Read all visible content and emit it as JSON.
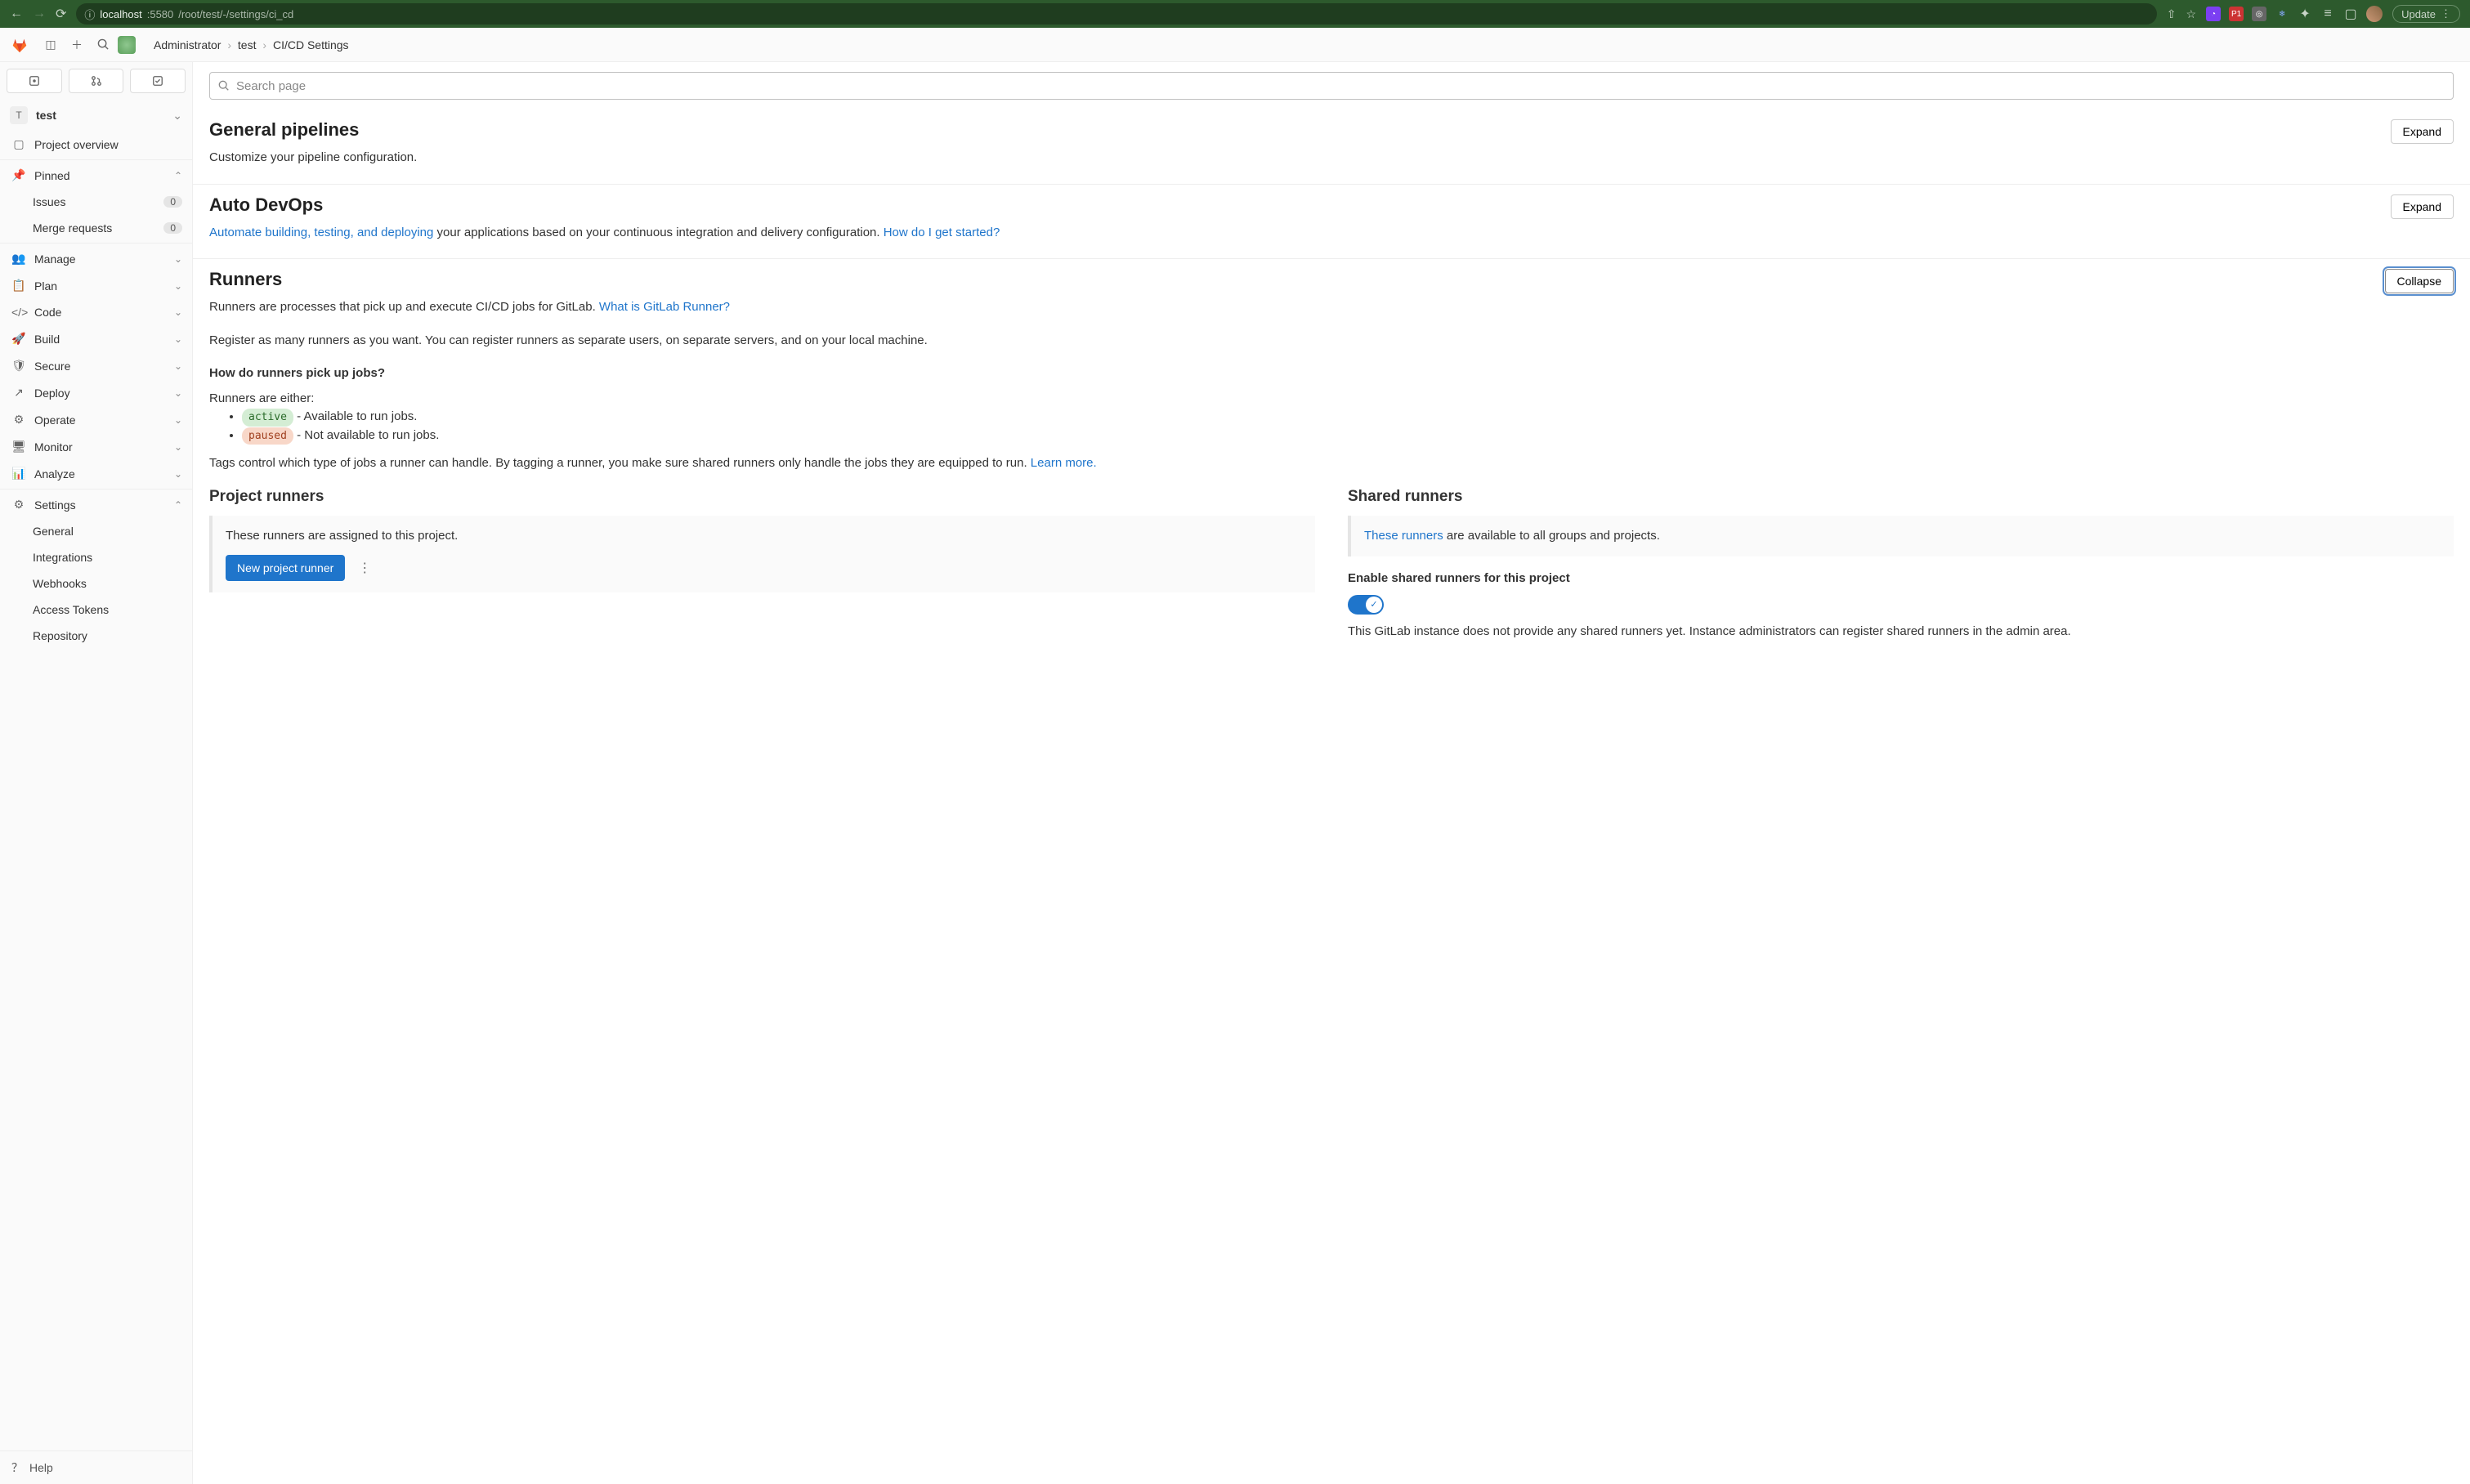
{
  "browser": {
    "url_host": "localhost",
    "url_port": ":5580",
    "url_path": "/root/test/-/settings/ci_cd",
    "update_label": "Update"
  },
  "breadcrumbs": {
    "items": [
      "Administrator",
      "test",
      "CI/CD Settings"
    ]
  },
  "project": {
    "avatar_letter": "T",
    "name": "test"
  },
  "sidebar": {
    "shortcuts": {
      "issues": "⊡",
      "mrs": "⤲",
      "todos": "☑"
    },
    "overview": "Project overview",
    "pinned": "Pinned",
    "pinned_items": [
      {
        "label": "Issues",
        "count": "0"
      },
      {
        "label": "Merge requests",
        "count": "0"
      }
    ],
    "items": [
      "Manage",
      "Plan",
      "Code",
      "Build",
      "Secure",
      "Deploy",
      "Operate",
      "Monitor",
      "Analyze"
    ],
    "settings": "Settings",
    "settings_items": [
      "General",
      "Integrations",
      "Webhooks",
      "Access Tokens",
      "Repository"
    ],
    "help": "Help"
  },
  "search": {
    "placeholder": "Search page"
  },
  "sections": {
    "general": {
      "title": "General pipelines",
      "desc": "Customize your pipeline configuration.",
      "btn": "Expand"
    },
    "devops": {
      "title": "Auto DevOps",
      "link1": "Automate building, testing, and deploying",
      "desc_mid": " your applications based on your continuous integration and delivery configuration. ",
      "link2": "How do I get started?",
      "btn": "Expand"
    },
    "runners": {
      "title": "Runners",
      "btn": "Collapse",
      "desc1": "Runners are processes that pick up and execute CI/CD jobs for GitLab. ",
      "link1": "What is GitLab Runner?",
      "desc2": "Register as many runners as you want. You can register runners as separate users, on separate servers, and on your local machine.",
      "subhead": "How do runners pick up jobs?",
      "either": "Runners are either:",
      "active_pill": "active",
      "active_text": "  - Available to run jobs.",
      "paused_pill": "paused",
      "paused_text": "  - Not available to run jobs.",
      "tags": "Tags control which type of jobs a runner can handle. By tagging a runner, you make sure shared runners only handle the jobs they are equipped to run. ",
      "learn_more": "Learn more.",
      "project_runners": {
        "title": "Project runners",
        "desc": "These runners are assigned to this project.",
        "btn": "New project runner"
      },
      "shared_runners": {
        "title": "Shared runners",
        "link": "These runners",
        "desc": " are available to all groups and projects.",
        "toggle_label": "Enable shared runners for this project",
        "help": "This GitLab instance does not provide any shared runners yet. Instance administrators can register shared runners in the admin area."
      }
    }
  }
}
